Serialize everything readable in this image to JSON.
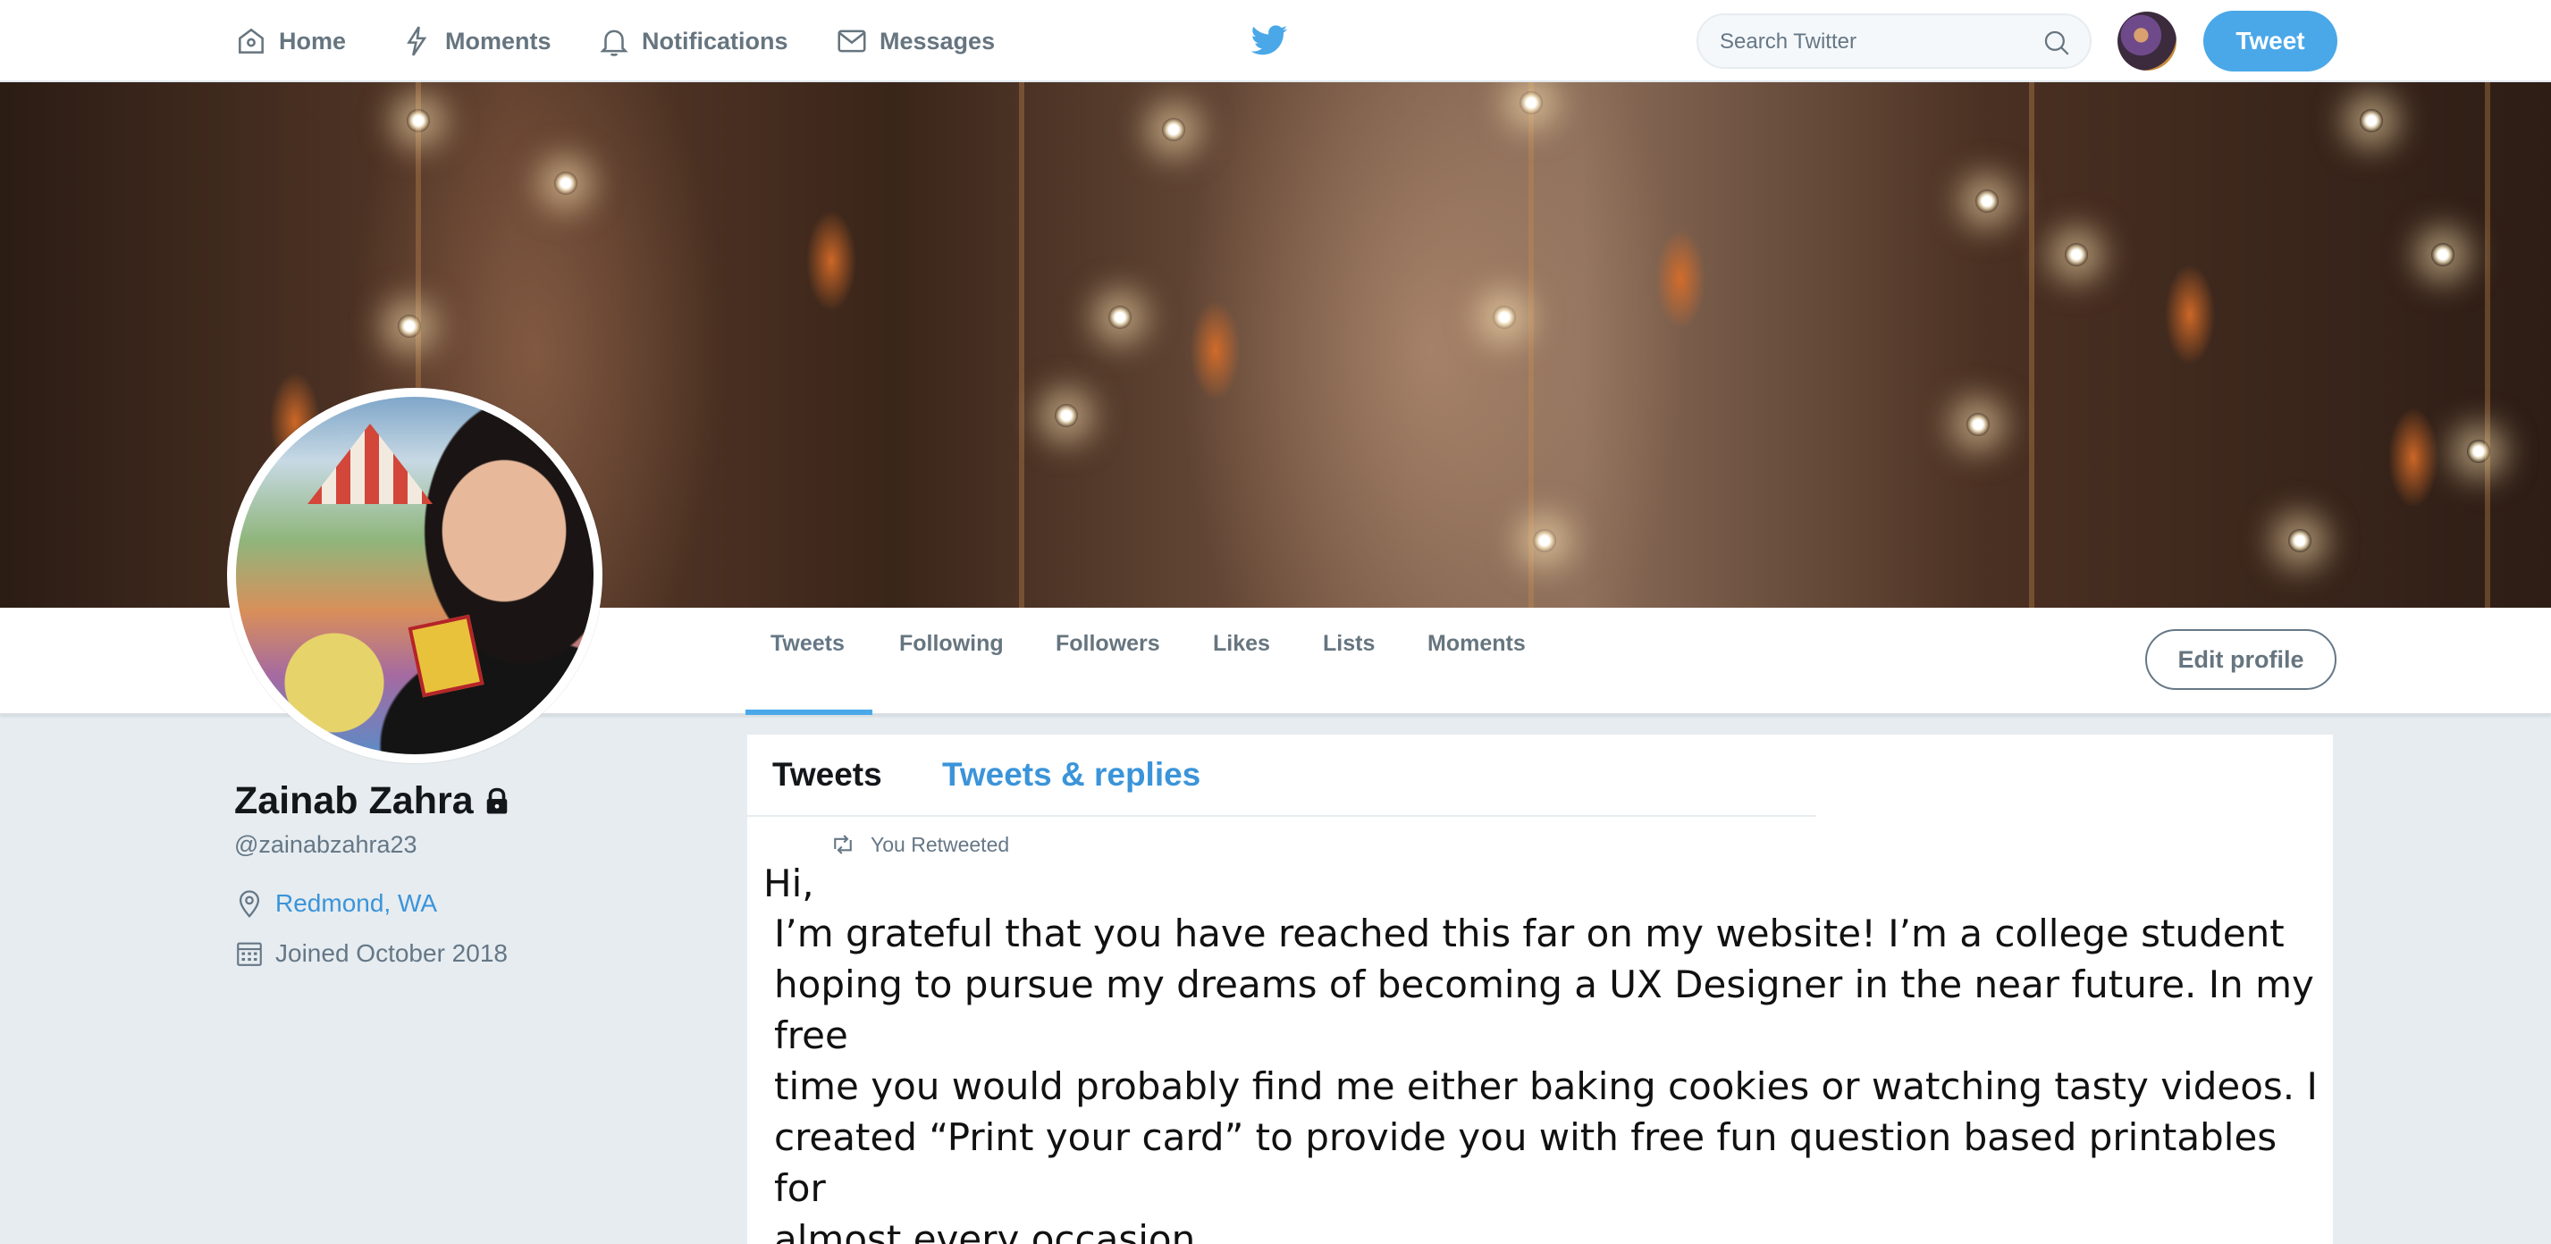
{
  "top_nav": {
    "home": "Home",
    "moments": "Moments",
    "notifications": "Notifications",
    "messages": "Messages",
    "search_placeholder": "Search Twitter",
    "tweet_button": "Tweet"
  },
  "profile_nav": {
    "tabs": [
      {
        "label": "Tweets"
      },
      {
        "label": "Following"
      },
      {
        "label": "Followers"
      },
      {
        "label": "Likes"
      },
      {
        "label": "Lists"
      },
      {
        "label": "Moments"
      }
    ],
    "edit_profile": "Edit profile"
  },
  "profile": {
    "name": "Zainab Zahra",
    "handle": "@zainabzahra23",
    "location": "Redmond, WA",
    "joined": "Joined October 2018"
  },
  "timeline": {
    "tabs": [
      "Tweets",
      "Tweets & replies"
    ],
    "retweet_label": "You Retweeted",
    "greeting": "Hi,",
    "body": "I’m grateful that you have reached this far on my website! I’m a college student\nhoping to pursue my dreams of becoming a UX Designer in the near future. In my free\ntime you would probably find me either baking cookies or watching tasty videos. I\ncreated “Print your card” to provide you with free fun question based printables for\nalmost every occasion.."
  },
  "colors": {
    "accent": "#4aa8e8",
    "link": "#3b94d9",
    "muted": "#657786",
    "background": "#e6ecf0"
  },
  "icons": [
    "home-icon",
    "moments-icon",
    "notifications-icon",
    "messages-icon",
    "twitter-bird-icon",
    "search-icon",
    "lock-icon",
    "location-icon",
    "calendar-icon",
    "retweet-icon"
  ]
}
